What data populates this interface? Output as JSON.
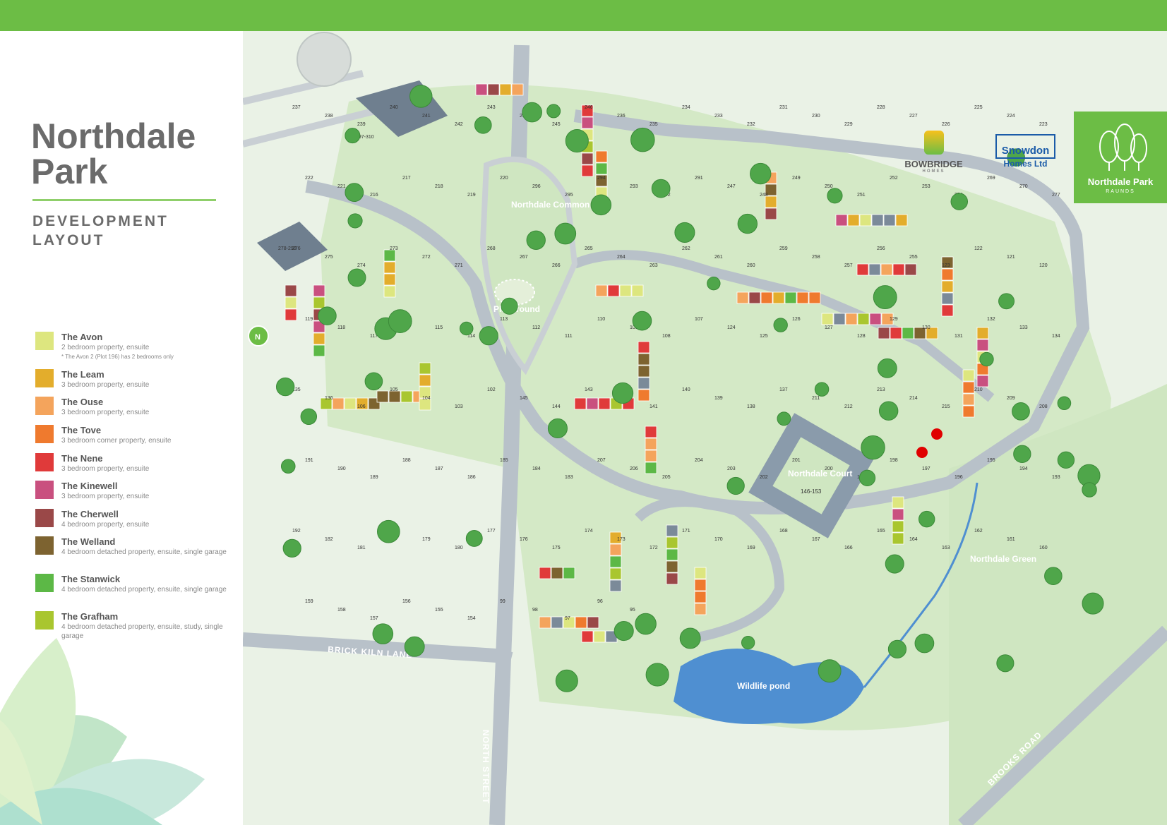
{
  "header": {
    "title_line1": "Northdale",
    "title_line2": "Park",
    "subtitle_line1": "DEVELOPMENT",
    "subtitle_line2": "LAYOUT"
  },
  "legend": [
    {
      "name": "The Avon",
      "desc": "2 bedroom property, ensuite",
      "note": "* The Avon 2 (Plot 196) has 2 bedrooms only",
      "color": "#dde67f"
    },
    {
      "name": "The Leam",
      "desc": "3 bedroom property, ensuite",
      "color": "#e3ad2c"
    },
    {
      "name": "The Ouse",
      "desc": "3 bedroom property, ensuite",
      "color": "#f4a45c"
    },
    {
      "name": "The Tove",
      "desc": "3 bedroom corner property, ensuite",
      "color": "#ef7a2e"
    },
    {
      "name": "The Nene",
      "desc": "3 bedroom property, ensuite",
      "color": "#e03a3a"
    },
    {
      "name": "The Kinewell",
      "desc": "3 bedroom property, ensuite",
      "color": "#c9507f"
    },
    {
      "name": "The Cherwell",
      "desc": "4 bedroom property, ensuite",
      "color": "#9a4848"
    },
    {
      "name": "The Welland",
      "desc": "4 bedroom detached property, ensuite, single garage",
      "color": "#7d6330"
    },
    {
      "name": "The Stanwick",
      "desc": "4 bedroom detached property, ensuite, single garage",
      "color": "#5cb846"
    },
    {
      "name": "The Grafham",
      "desc": "4 bedroom detached property, ensuite, study, single garage",
      "color": "#a9c62f"
    }
  ],
  "map": {
    "compass": "N",
    "roads": [
      "BRICK KILN LANE",
      "NORTH STREET",
      "BROOKS ROAD"
    ],
    "areas": [
      "Northdale Common",
      "Playground",
      "Northdale Court",
      "146-153",
      "Northdale Green",
      "Wildlife pond",
      "278-290",
      "297-310"
    ],
    "plots": [
      "237",
      "238",
      "239",
      "240",
      "241",
      "242",
      "243",
      "244",
      "245",
      "246",
      "236",
      "235",
      "234",
      "233",
      "232",
      "231",
      "230",
      "229",
      "228",
      "227",
      "226",
      "225",
      "224",
      "223",
      "222",
      "221",
      "216",
      "217",
      "218",
      "219",
      "220",
      "296",
      "295",
      "294",
      "293",
      "292",
      "291",
      "247",
      "248",
      "249",
      "250",
      "251",
      "252",
      "253",
      "254",
      "269",
      "270",
      "277",
      "276",
      "275",
      "274",
      "273",
      "272",
      "271",
      "268",
      "267",
      "266",
      "265",
      "264",
      "263",
      "262",
      "261",
      "260",
      "259",
      "258",
      "257",
      "256",
      "255",
      "123",
      "122",
      "121",
      "120",
      "119",
      "118",
      "117",
      "116",
      "115",
      "114",
      "113",
      "112",
      "111",
      "110",
      "109",
      "108",
      "107",
      "124",
      "125",
      "126",
      "127",
      "128",
      "129",
      "130",
      "131",
      "132",
      "133",
      "134",
      "135",
      "136",
      "106",
      "105",
      "104",
      "103",
      "102",
      "145",
      "144",
      "143",
      "142",
      "141",
      "140",
      "139",
      "138",
      "137",
      "211",
      "212",
      "213",
      "214",
      "215",
      "210",
      "209",
      "208",
      "191",
      "190",
      "189",
      "188",
      "187",
      "186",
      "185",
      "184",
      "183",
      "207",
      "206",
      "205",
      "204",
      "203",
      "202",
      "201",
      "200",
      "199",
      "198",
      "197",
      "196",
      "195",
      "194",
      "193",
      "192",
      "182",
      "181",
      "178",
      "179",
      "180",
      "177",
      "176",
      "175",
      "174",
      "173",
      "172",
      "171",
      "170",
      "169",
      "168",
      "167",
      "166",
      "165",
      "164",
      "163",
      "162",
      "161",
      "160",
      "159",
      "158",
      "157",
      "156",
      "155",
      "154",
      "99",
      "98",
      "97",
      "96",
      "95"
    ]
  },
  "brands": {
    "bowbridge": "BOWBRIDGE",
    "bowbridge_sub": "HOMES",
    "snowdon_line1": "Snowdon",
    "snowdon_line2": "Homes Ltd",
    "logo_name": "Northdale Park",
    "logo_sub": "RAUNDS"
  },
  "colors": {
    "brand_green": "#6cbd45",
    "road": "#b8c1c9",
    "grass": "#cfe6c1",
    "water": "#4f8fd1"
  }
}
